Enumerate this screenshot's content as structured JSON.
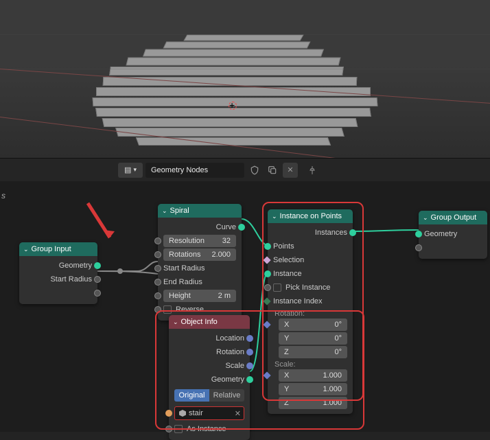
{
  "header": {
    "workspace_title": "Geometry Nodes"
  },
  "axis": "s",
  "group_input": {
    "title": "Group Input",
    "outputs": [
      "Geometry",
      "Start Radius"
    ]
  },
  "spiral": {
    "title": "Spiral",
    "output": "Curve",
    "resolution_label": "Resolution",
    "resolution_value": "32",
    "rotations_label": "Rotations",
    "rotations_value": "2.000",
    "start_radius_label": "Start Radius",
    "end_radius_label": "End Radius",
    "height_label": "Height",
    "height_value": "2 m",
    "reverse_label": "Reverse"
  },
  "object_info": {
    "title": "Object Info",
    "outputs": [
      "Location",
      "Rotation",
      "Scale",
      "Geometry"
    ],
    "tabs": {
      "original": "Original",
      "relative": "Relative"
    },
    "object_name": "stair",
    "as_instance_label": "As Instance"
  },
  "instance_on_points": {
    "title": "Instance on Points",
    "output": "Instances",
    "inputs": {
      "points": "Points",
      "selection": "Selection",
      "instance": "Instance",
      "pick_instance": "Pick Instance",
      "instance_index": "Instance Index"
    },
    "rotation_label": "Rotation:",
    "rotation": {
      "x_label": "X",
      "x": "0°",
      "y_label": "Y",
      "y": "0°",
      "z_label": "Z",
      "z": "0°"
    },
    "scale_label": "Scale:",
    "scale": {
      "x_label": "X",
      "x": "1.000",
      "y_label": "Y",
      "y": "1.000",
      "z_label": "Z",
      "z": "1.000"
    }
  },
  "group_output": {
    "title": "Group Output",
    "input": "Geometry"
  }
}
